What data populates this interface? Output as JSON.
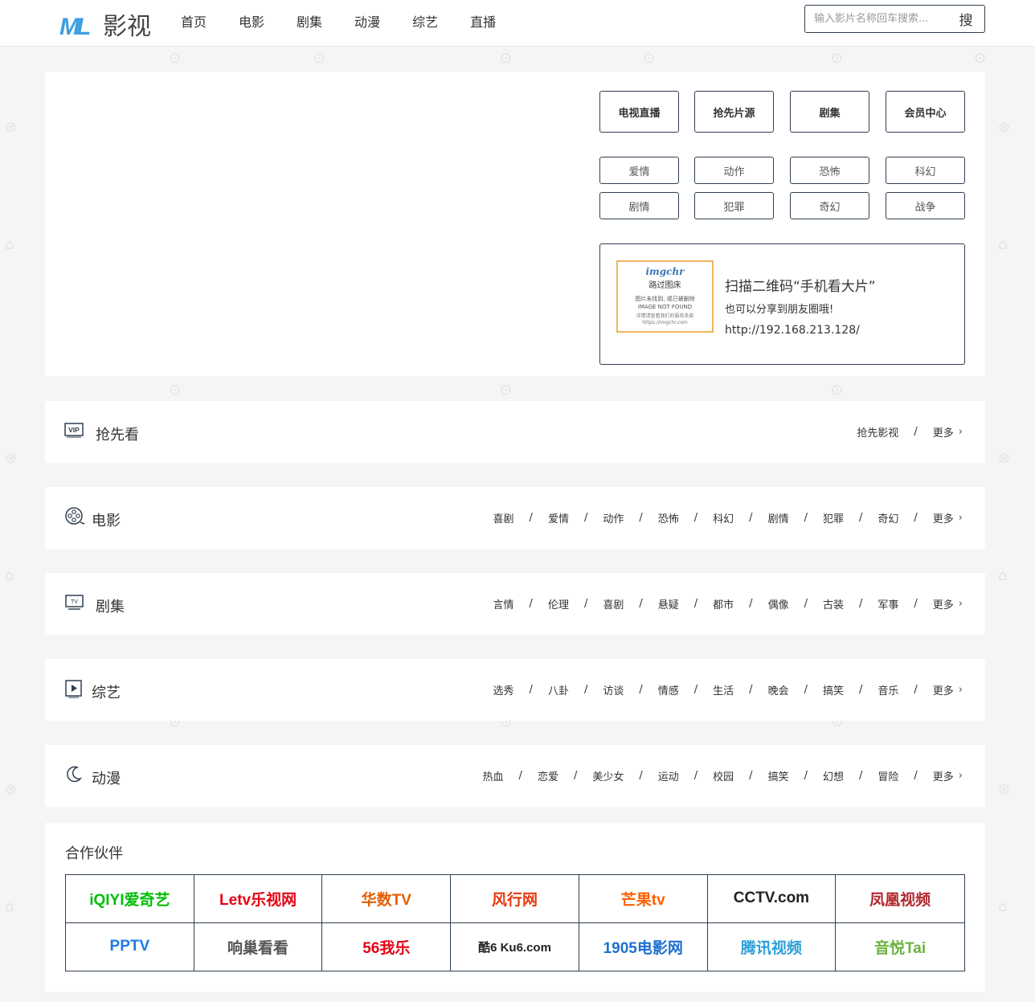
{
  "header": {
    "logo_text": "影视",
    "logo_mark": "ML",
    "nav": [
      "首页",
      "电影",
      "剧集",
      "动漫",
      "综艺",
      "直播"
    ],
    "search_placeholder": "输入影片名称回车搜索...",
    "search_button": "搜"
  },
  "hero": {
    "big_buttons": [
      "电视直播",
      "抢先片源",
      "剧集",
      "会员中心"
    ],
    "small_buttons": [
      "爱情",
      "动作",
      "恐怖",
      "科幻",
      "剧情",
      "犯罪",
      "奇幻",
      "战争"
    ],
    "qr": {
      "image_brand": "imgchr",
      "image_line1": "路过图床",
      "image_line2a": "图片未找到, 或已被删除",
      "image_line2b": "IMAGE NOT FOUND",
      "image_line3a": "详情请查看我们的服务条款",
      "image_line3b": "https://imgchr.com",
      "title": "扫描二维码“手机看大片”",
      "subtitle": "也可以分享到朋友圈哦!",
      "url": "http://192.168.213.128/"
    }
  },
  "sections": [
    {
      "title": "抢先看",
      "icon": "vip-icon",
      "links": [
        "抢先影视"
      ],
      "more": "更多"
    },
    {
      "title": "电影",
      "icon": "film-reel-icon",
      "links": [
        "喜剧",
        "爱情",
        "动作",
        "恐怖",
        "科幻",
        "剧情",
        "犯罪",
        "奇幻"
      ],
      "more": "更多"
    },
    {
      "title": "剧集",
      "icon": "tv-icon",
      "links": [
        "言情",
        "伦理",
        "喜剧",
        "悬疑",
        "都市",
        "偶像",
        "古装",
        "军事"
      ],
      "more": "更多"
    },
    {
      "title": "综艺",
      "icon": "play-box-icon",
      "links": [
        "选秀",
        "八卦",
        "访谈",
        "情感",
        "生活",
        "晚会",
        "搞笑",
        "音乐"
      ],
      "more": "更多"
    },
    {
      "title": "动漫",
      "icon": "moon-icon",
      "links": [
        "热血",
        "恋爱",
        "美少女",
        "运动",
        "校园",
        "搞笑",
        "幻想",
        "冒险"
      ],
      "more": "更多"
    }
  ],
  "partners": {
    "title": "合作伙伴",
    "logos": [
      {
        "text": "iQIYI爱奇艺",
        "color": "#00be06"
      },
      {
        "text": "Letv乐视网",
        "color": "#e60012"
      },
      {
        "text": "华数TV",
        "color": "#e65c00"
      },
      {
        "text": "风行网",
        "color": "#e8380d"
      },
      {
        "text": "芒果tv",
        "color": "#ff5f00"
      },
      {
        "text": "CCTV.com",
        "color": "#222222"
      },
      {
        "text": "凤凰视频",
        "color": "#b2282e"
      },
      {
        "text": "PPTV",
        "color": "#1e7be5"
      },
      {
        "text": "响巢看看",
        "color": "#555555"
      },
      {
        "text": "56我乐",
        "color": "#e60012"
      },
      {
        "text": "酷6 Ku6.com",
        "color": "#222222"
      },
      {
        "text": "1905电影网",
        "color": "#1e6fd0"
      },
      {
        "text": "腾讯视频",
        "color": "#2d9fd8"
      },
      {
        "text": "音悦Tai",
        "color": "#6db33f"
      }
    ]
  }
}
